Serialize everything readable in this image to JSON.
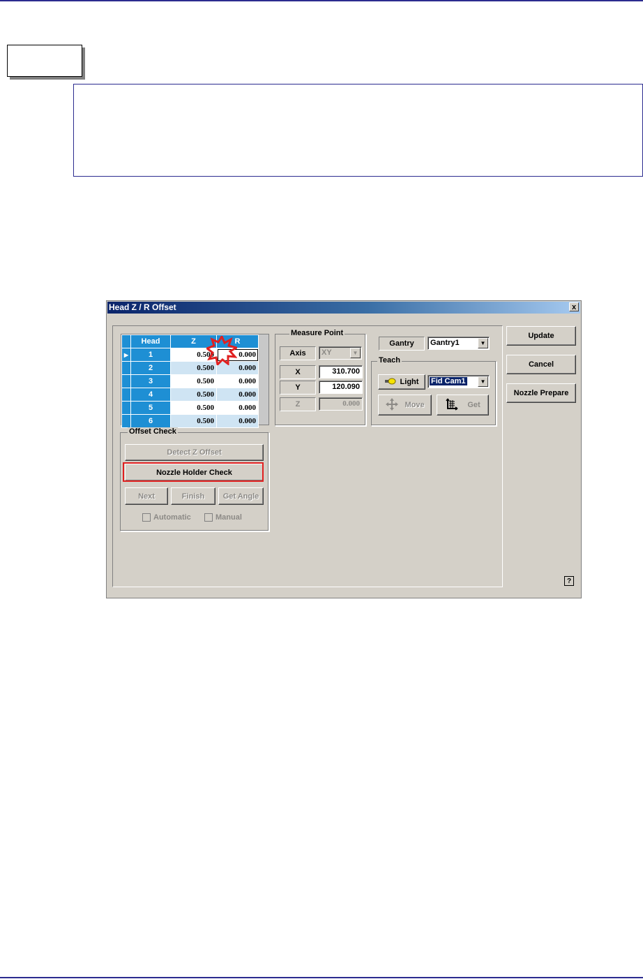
{
  "dialog": {
    "title": "Head Z / R Offset",
    "close_label": "x",
    "grid": {
      "columns": [
        "Head",
        "Z",
        "R"
      ],
      "row_indicator": "▶",
      "rows": [
        {
          "head": "1",
          "z": "0.500",
          "r": "0.000"
        },
        {
          "head": "2",
          "z": "0.500",
          "r": "0.000"
        },
        {
          "head": "3",
          "z": "0.500",
          "r": "0.000"
        },
        {
          "head": "4",
          "z": "0.500",
          "r": "0.000"
        },
        {
          "head": "5",
          "z": "0.500",
          "r": "0.000"
        },
        {
          "head": "6",
          "z": "0.500",
          "r": "0.000"
        }
      ]
    },
    "measure_point": {
      "label": "Measure Point",
      "axis_label": "Axis",
      "axis_value": "XY",
      "x_label": "X",
      "x_value": "310.700",
      "y_label": "Y",
      "y_value": "120.090",
      "z_label": "Z",
      "z_value": "0.000"
    },
    "gantry": {
      "label": "Gantry",
      "value": "Gantry1"
    },
    "teach": {
      "label": "Teach",
      "light_label": "Light",
      "camera_value": "Fid Cam1",
      "move_label": "Move",
      "get_label": "Get"
    },
    "offset_check": {
      "label": "Offset Check",
      "detect_label": "Detect Z Offset",
      "nozzle_holder_label": "Nozzle Holder Check",
      "next_label": "Next",
      "finish_label": "Finish",
      "get_angle_label": "Get Angle",
      "automatic_label": "Automatic",
      "manual_label": "Manual"
    },
    "buttons": {
      "update": "Update",
      "cancel": "Cancel",
      "nozzle_prepare": "Nozzle Prepare",
      "help": "?"
    }
  },
  "highlight_color": "#e02020"
}
